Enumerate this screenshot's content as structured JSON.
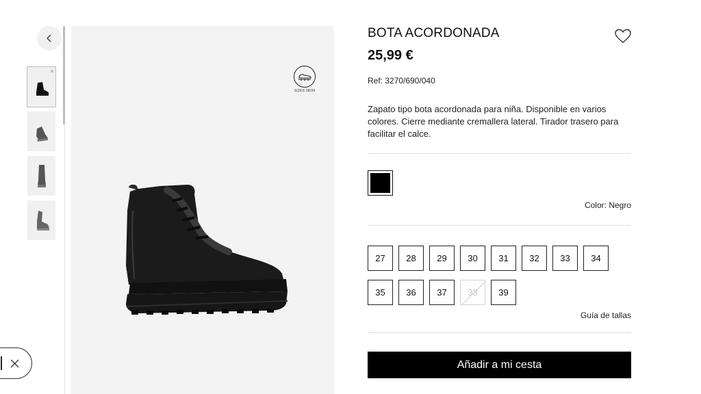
{
  "product": {
    "title": "BOTA ACORDONADA",
    "price": "25,99 €",
    "ref": "Ref: 3270/690/040",
    "description": "Zapato tipo bota acordonada para niña. Disponible en varios colores. Cierre mediante cremallera lateral. Tirador trasero para facilitar el calce."
  },
  "gallery": {
    "size_badge_caption": "SIZES 38/39",
    "thumbnails": [
      "boot-side-view",
      "boot-angle-view",
      "boot-front-view",
      "boot-back-view"
    ]
  },
  "colors": {
    "label": "Color: Negro",
    "swatches": [
      {
        "name": "Negro",
        "hex": "#000000",
        "selected": true
      }
    ]
  },
  "sizes": {
    "options": [
      {
        "label": "27",
        "available": true
      },
      {
        "label": "28",
        "available": true
      },
      {
        "label": "29",
        "available": true
      },
      {
        "label": "30",
        "available": true
      },
      {
        "label": "31",
        "available": true
      },
      {
        "label": "32",
        "available": true
      },
      {
        "label": "33",
        "available": true
      },
      {
        "label": "34",
        "available": true
      },
      {
        "label": "35",
        "available": true
      },
      {
        "label": "36",
        "available": true
      },
      {
        "label": "37",
        "available": true
      },
      {
        "label": "38",
        "available": false
      },
      {
        "label": "39",
        "available": true
      }
    ],
    "guide_label": "Guía de tallas"
  },
  "cart": {
    "add_label": "Añadir a mi cesta"
  },
  "icons": {
    "back": "chevron-left-icon",
    "wishlist": "heart-icon",
    "close": "close-icon",
    "size_badge": "shoe-size-icon"
  },
  "colors_theme": {
    "primary": "#000000",
    "background": "#ffffff",
    "image_bg": "#f3f3f3",
    "border": "#dedede"
  }
}
